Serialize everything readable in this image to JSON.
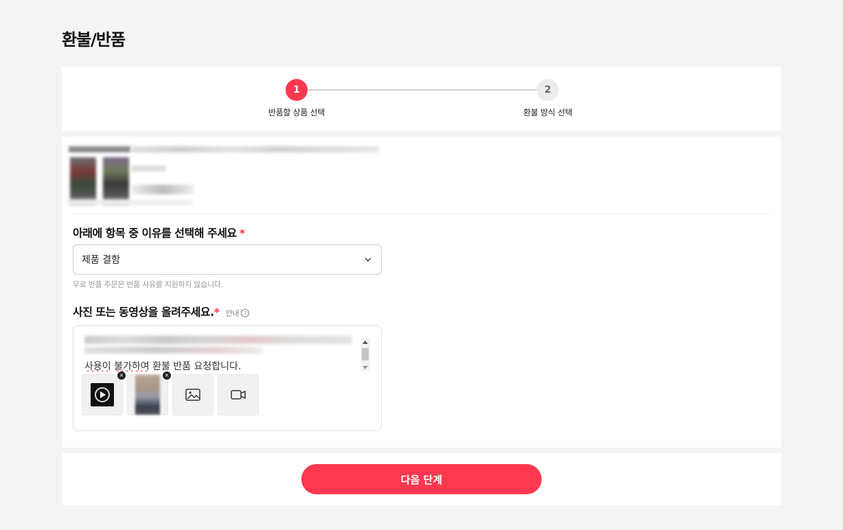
{
  "page": {
    "title": "환불/반품"
  },
  "stepper": {
    "steps": [
      {
        "number": "1",
        "label": "반품할 상품 선택"
      },
      {
        "number": "2",
        "label": "환불 방식 선택"
      }
    ]
  },
  "reason": {
    "label": "아래에 항목 중 이유를 선택해 주세요",
    "required_mark": "*",
    "selected": "제품 결함",
    "hint": "무료 반품 주문은 반품 사유를 지원하지 않습니다."
  },
  "upload": {
    "label": "사진 또는 동영상을 올려주세요.",
    "required_mark": "*",
    "guide": "안내",
    "guide_icon": "?",
    "text_visible": "사용이 불가하여 환불 반품 요청합니다.",
    "remove_icon": "×"
  },
  "footer": {
    "next_label": "다음 단계"
  },
  "colors": {
    "accent": "#ff3850",
    "background": "#f4f4f4"
  }
}
